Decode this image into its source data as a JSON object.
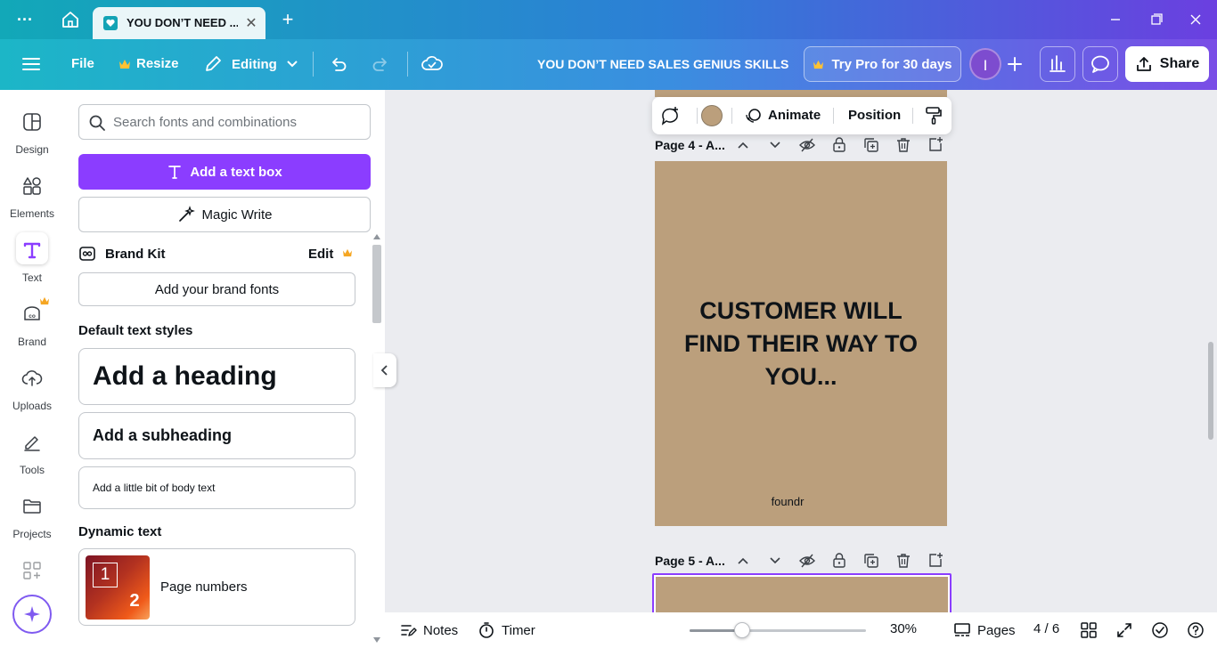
{
  "browser": {
    "tab_title": "YOU DON’T NEED ...",
    "tab_close": "✕",
    "new_tab": "+"
  },
  "header": {
    "file_label": "File",
    "resize_label": "Resize",
    "editing_label": "Editing",
    "doc_title": "YOU DON’T NEED SALES GENIUS SKILLS",
    "try_pro_label": "Try Pro for 30 days",
    "avatar_initial": "I",
    "share_label": "Share"
  },
  "rail": {
    "items": [
      {
        "label": "Design"
      },
      {
        "label": "Elements"
      },
      {
        "label": "Text"
      },
      {
        "label": "Brand"
      },
      {
        "label": "Uploads"
      },
      {
        "label": "Tools"
      },
      {
        "label": "Projects"
      }
    ]
  },
  "panel": {
    "search_placeholder": "Search fonts and combinations",
    "add_text_box": "Add a text box",
    "magic_write": "Magic Write",
    "brand_kit": "Brand Kit",
    "brand_kit_edit": "Edit",
    "add_brand_fonts": "Add your brand fonts",
    "default_styles_title": "Default text styles",
    "heading": "Add a heading",
    "subheading": "Add a subheading",
    "body": "Add a little bit of body text",
    "dynamic_title": "Dynamic text",
    "page_numbers": "Page numbers",
    "page_numbers_thumb": [
      "1",
      "2"
    ]
  },
  "canvas": {
    "toolbar": {
      "animate": "Animate",
      "position": "Position",
      "color_swatch": "#bb9f7c"
    },
    "page4_label": "Page 4 - A...",
    "page4_headline": "CUSTOMER WILL FIND THEIR WAY TO YOU...",
    "page4_brand": "foundr",
    "page5_label": "Page 5 - A...",
    "page_color": "#bb9f7c"
  },
  "footer": {
    "notes": "Notes",
    "timer": "Timer",
    "zoom": "30%",
    "zoom_level": 0.3,
    "pages_label": "Pages",
    "page_count": "4 / 6"
  },
  "colors": {
    "accent": "#8b3dff",
    "header_gradient_start": "#1cb6c7",
    "header_gradient_end": "#7a4de6"
  }
}
